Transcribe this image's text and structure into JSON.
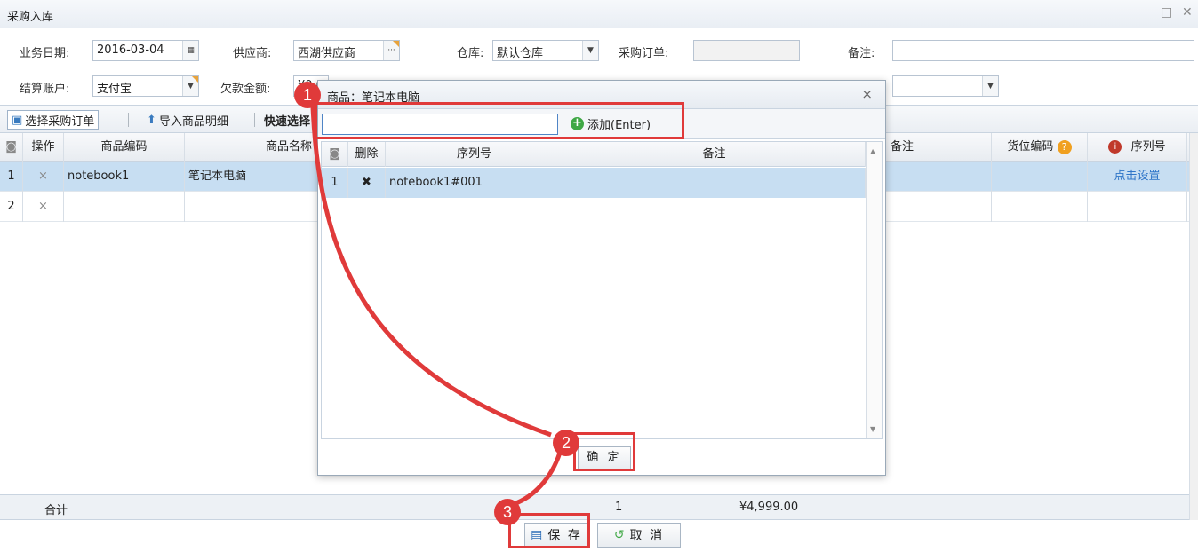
{
  "window": {
    "title": "采购入库"
  },
  "form": {
    "date_label": "业务日期:",
    "date_value": "2016-03-04",
    "supplier_label": "供应商:",
    "supplier_value": "西湖供应商",
    "warehouse_label": "仓库:",
    "warehouse_value": "默认仓库",
    "po_label": "采购订单:",
    "po_value": "",
    "note_label": "备注:",
    "note_value": "",
    "account_label": "结算账户:",
    "account_value": "支付宝",
    "debt_label": "欠款金额:",
    "debt_value": "¥0.00"
  },
  "toolbar": {
    "select_po": "选择采购订单",
    "import_items": "导入商品明细",
    "quick_select": "快速选择"
  },
  "grid": {
    "columns": [
      "操作",
      "商品编码",
      "商品名称",
      "备注",
      "货位编码",
      "序列号"
    ],
    "rows": [
      {
        "num": "1",
        "op": "×",
        "code": "notebook1",
        "name": "笔记本电脑",
        "serial": "点击设置"
      },
      {
        "num": "2",
        "op": "×",
        "code": "",
        "name": "",
        "serial": ""
      }
    ],
    "total_label": "合计",
    "total_qty": "1",
    "total_amount": "¥4,999.00"
  },
  "dialog": {
    "title": "商品：笔记本电脑",
    "add_label": "添加(Enter)",
    "columns": [
      "删除",
      "序列号",
      "备注"
    ],
    "rows": [
      {
        "num": "1",
        "del": "✖",
        "serial": "notebook1#001",
        "note": ""
      }
    ],
    "ok_label": "确 定"
  },
  "actions": {
    "save": "保 存",
    "cancel": "取 消"
  },
  "annotations": {
    "step1": "1",
    "step2": "2",
    "step3": "3"
  },
  "colors": {
    "accent_red": "#e03a3a",
    "selected_row": "#c7def2",
    "link": "#2f75c8"
  }
}
